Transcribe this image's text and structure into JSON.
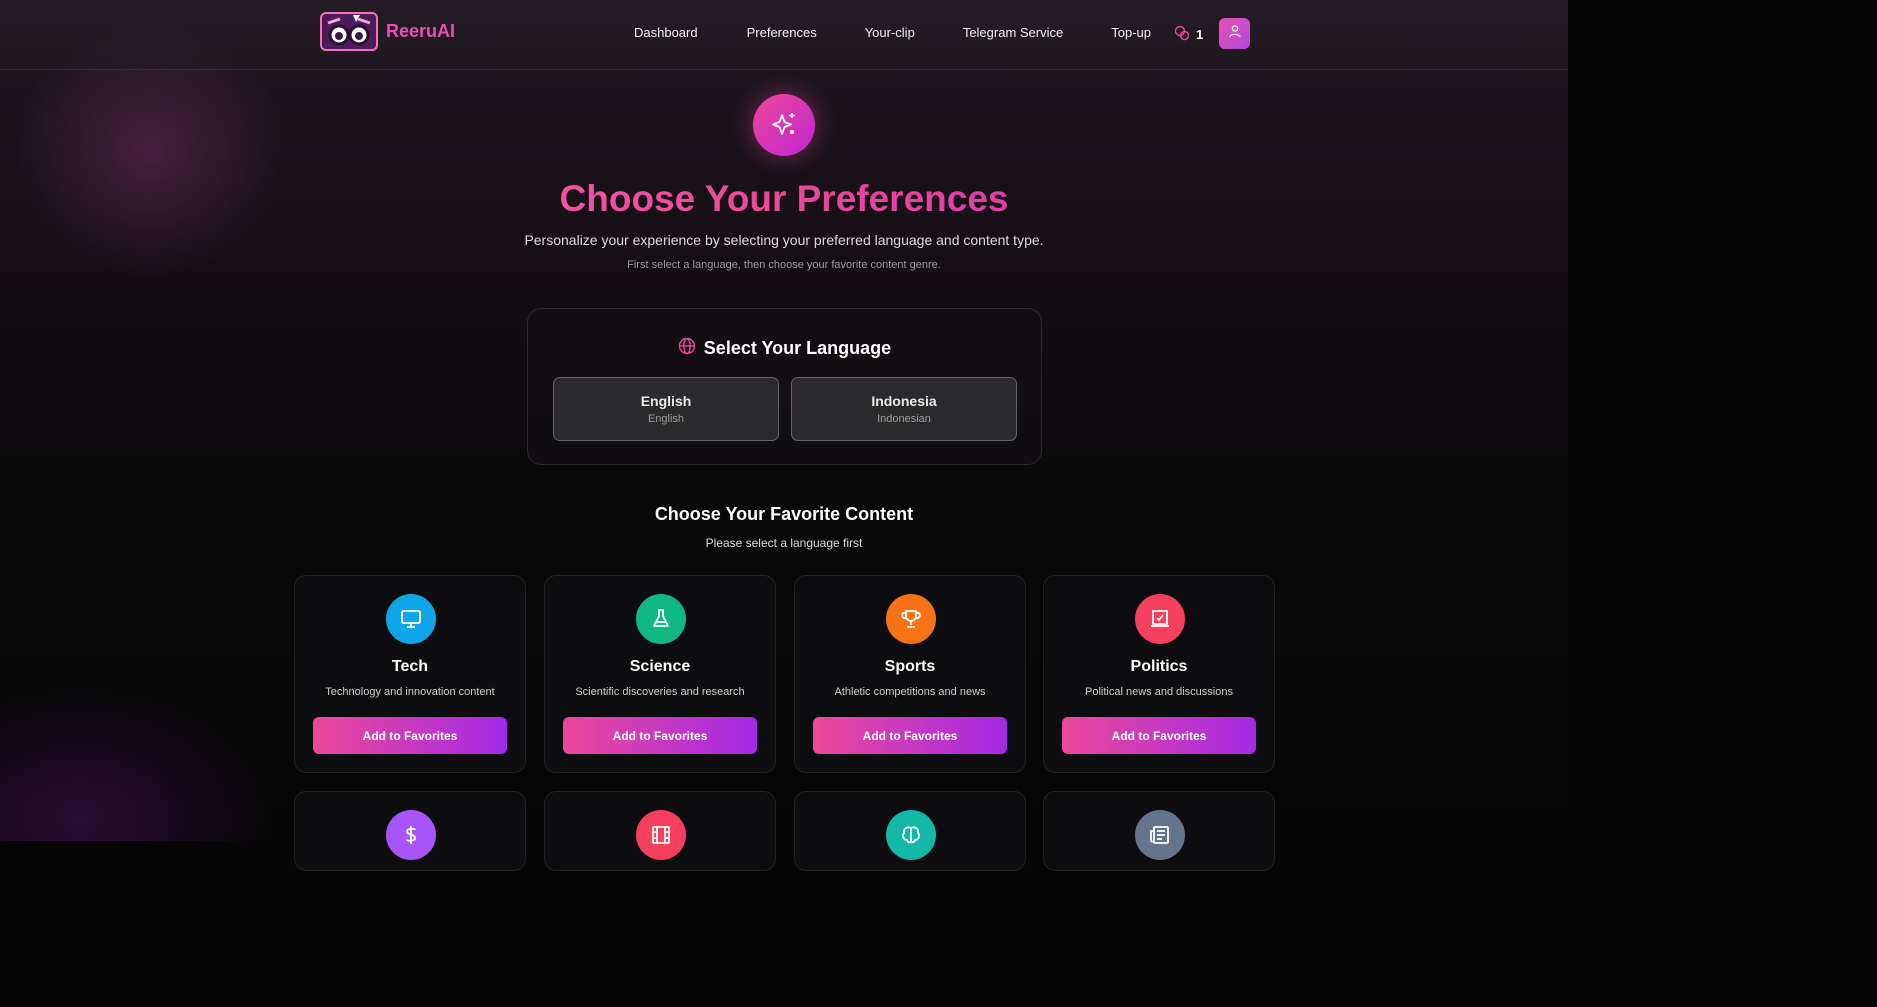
{
  "brand": {
    "name": "ReeruAI"
  },
  "nav": {
    "items": [
      "Dashboard",
      "Preferences",
      "Your-clip",
      "Telegram Service",
      "Top-up"
    ],
    "credits": "1"
  },
  "hero": {
    "title": "Choose Your Preferences",
    "subtitle": "Personalize your experience by selecting your preferred language and content type.",
    "hint": "First select a language, then choose your favorite content genre."
  },
  "language": {
    "title": "Select Your Language",
    "options": [
      {
        "name": "English",
        "native": "English"
      },
      {
        "name": "Indonesia",
        "native": "Indonesian"
      }
    ]
  },
  "content": {
    "title": "Choose Your Favorite Content",
    "subtitle": "Please select a language first",
    "button_label": "Add to Favorites",
    "cards": [
      {
        "name": "Tech",
        "desc": "Technology and innovation content",
        "icon": "monitor-icon",
        "color": "#0ea5e9"
      },
      {
        "name": "Science",
        "desc": "Scientific discoveries and research",
        "icon": "flask-icon",
        "color": "#10b981"
      },
      {
        "name": "Sports",
        "desc": "Athletic competitions and news",
        "icon": "trophy-icon",
        "color": "#f97316"
      },
      {
        "name": "Politics",
        "desc": "Political news and discussions",
        "icon": "ballot-icon",
        "color": "#f43f5e"
      }
    ],
    "row2_icons": [
      {
        "icon": "dollar-icon",
        "color": "#a855f7"
      },
      {
        "icon": "film-icon",
        "color": "#f43f5e"
      },
      {
        "icon": "brain-icon",
        "color": "#14b8a6"
      },
      {
        "icon": "newspaper-icon",
        "color": "#64748b"
      }
    ]
  }
}
